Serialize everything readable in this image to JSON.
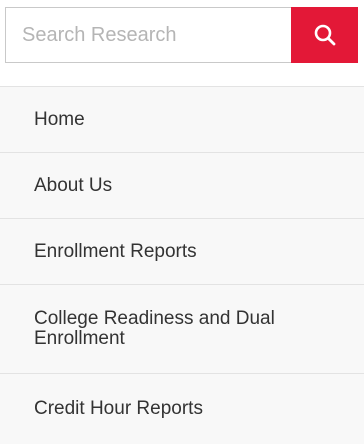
{
  "search": {
    "placeholder": "Search Research",
    "value": "",
    "button_icon": "search-icon",
    "button_color": "#e31837"
  },
  "nav": {
    "items": [
      {
        "label": "Home"
      },
      {
        "label": "About Us"
      },
      {
        "label": "Enrollment Reports"
      },
      {
        "label": "College Readiness and Dual Enrollment"
      },
      {
        "label": "Credit Hour Reports"
      }
    ]
  }
}
